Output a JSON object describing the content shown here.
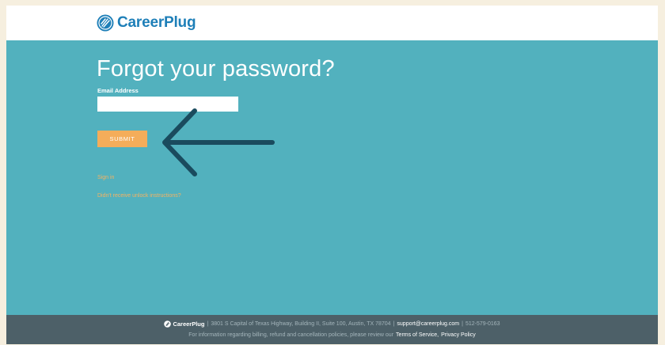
{
  "header": {
    "logo_text": "CareerPlug"
  },
  "page": {
    "title": "Forgot your password?"
  },
  "form": {
    "email_label": "Email Address",
    "email_value": "",
    "email_placeholder": "",
    "submit_label": "SUBMIT"
  },
  "links": {
    "sign_in": "Sign in",
    "unlock": "Didn't receive unlock instructions?"
  },
  "footer": {
    "logo_text": "CareerPlug",
    "sep1": "|",
    "address": "3801 S Capital of Texas Highway, Building II, Suite 100, Austin, TX 78704",
    "sep2": "|",
    "email": "support@careerplug.com",
    "sep3": "|",
    "phone": "512-579-0163",
    "policy_text": "For information regarding billing, refund and cancellation policies, please review our",
    "terms_link": "Terms of Service",
    "comma": ",",
    "privacy_link": "Privacy Policy"
  },
  "colors": {
    "page_background": "#52b1be",
    "brand_blue": "#1e7fb8",
    "accent_orange": "#f4ad5a",
    "footer_background": "#4d6068",
    "arrow": "#1a4b5e"
  },
  "icons": {
    "logo": "careerplug-logo-icon",
    "annotation": "arrow-left-annotation"
  }
}
